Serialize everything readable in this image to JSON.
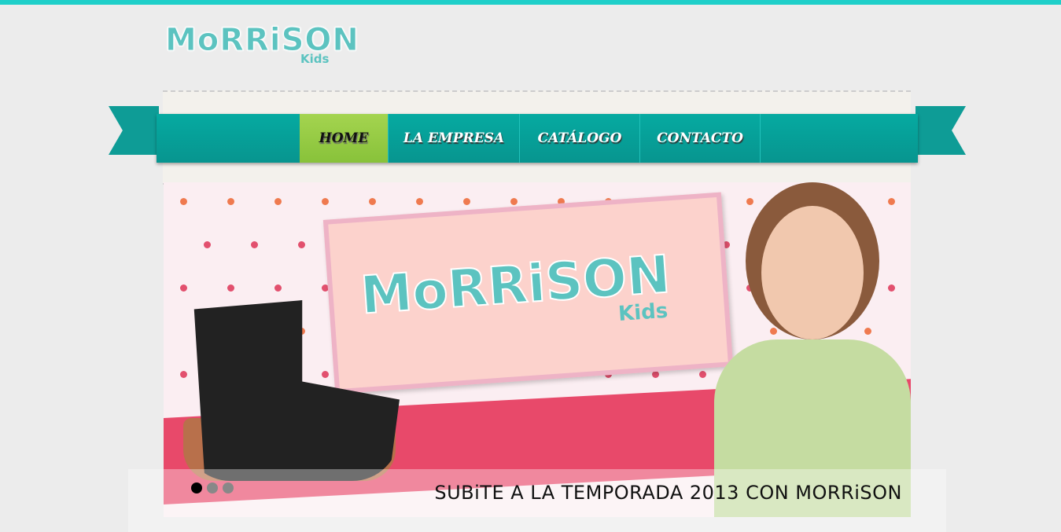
{
  "brand": {
    "logo_main": "MoRRiSON",
    "logo_sub": "Kids",
    "accent": "#1fcfc9",
    "nav_color": "#06aaa1",
    "active_color": "#a4d44f"
  },
  "nav": {
    "items": [
      {
        "label": "HOME",
        "active": true
      },
      {
        "label": "LA EMPRESA"
      },
      {
        "label": "CATÁLOGO"
      },
      {
        "label": "CONTACTO"
      }
    ]
  },
  "slider": {
    "sign_main": "MoRRiSON",
    "sign_sub": "Kids",
    "caption": "SUBiTE A LA TEMPORADA 2013 CON MORRiSON",
    "slides": 3,
    "current": 1
  }
}
